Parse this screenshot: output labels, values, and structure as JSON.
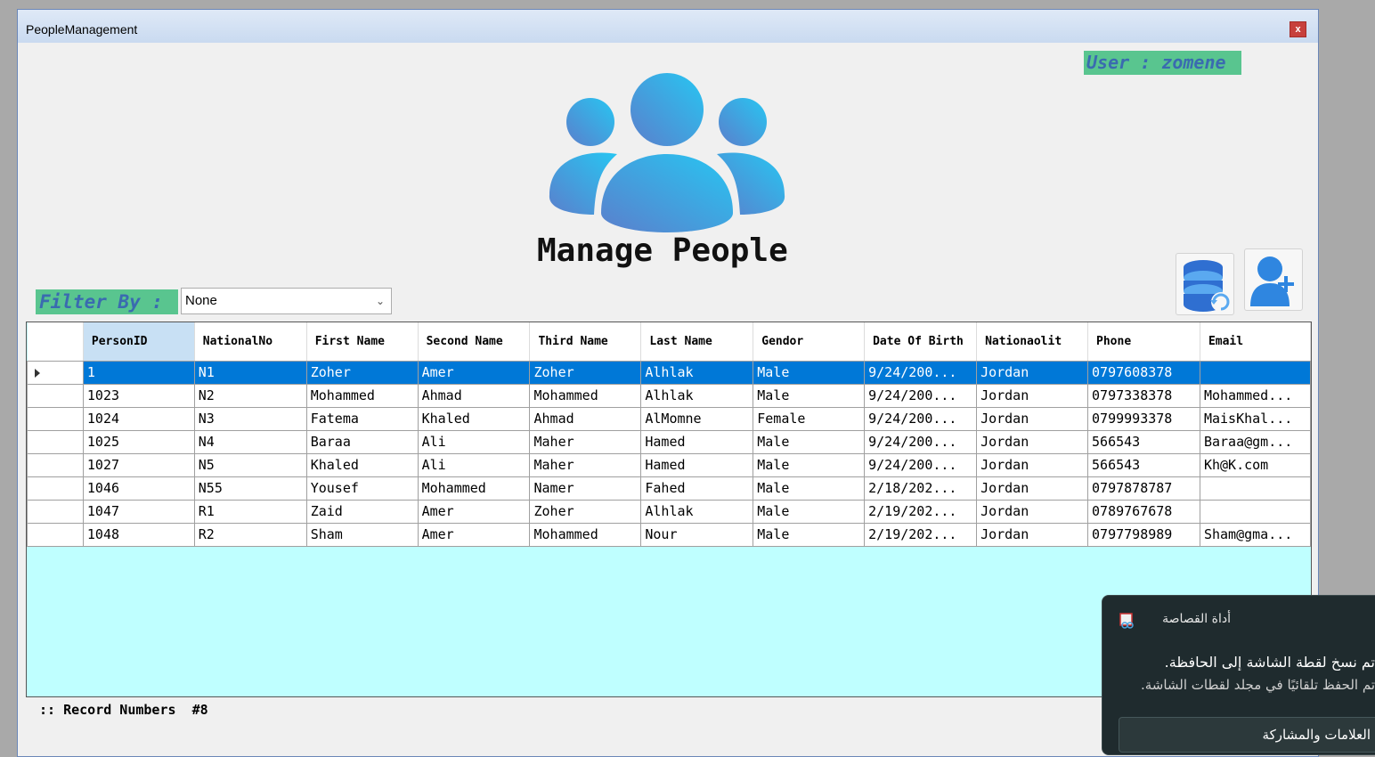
{
  "window": {
    "title": "PeopleManagement",
    "close_label": "x"
  },
  "user_badge": {
    "text": "User : zomene"
  },
  "page": {
    "title": "Manage People"
  },
  "filter": {
    "label": "Filter By :",
    "selected": "None"
  },
  "toolbar": {
    "refresh_icon": "database-refresh-icon",
    "add_icon": "add-person-icon"
  },
  "grid": {
    "columns": [
      "PersonID",
      "NationalNo",
      "First Name",
      "Second Name",
      "Third Name",
      "Last Name",
      "Gendor",
      "Date Of Birth",
      "Nationaolit",
      "Phone",
      "Email"
    ],
    "rows": [
      [
        "1",
        "N1",
        "Zoher",
        "Amer",
        "Zoher",
        "Alhlak",
        "Male",
        "9/24/200...",
        "Jordan",
        "0797608378",
        ""
      ],
      [
        "1023",
        "N2",
        "Mohammed",
        "Ahmad",
        "Mohammed",
        "Alhlak",
        "Male",
        "9/24/200...",
        "Jordan",
        "0797338378",
        "Mohammed..."
      ],
      [
        "1024",
        "N3",
        "Fatema",
        "Khaled",
        "Ahmad",
        "AlMomne",
        "Female",
        "9/24/200...",
        "Jordan",
        "0799993378",
        "MaisKhal..."
      ],
      [
        "1025",
        "N4",
        "Baraa",
        "Ali",
        "Maher",
        "Hamed",
        "Male",
        "9/24/200...",
        "Jordan",
        "566543",
        "Baraa@gm..."
      ],
      [
        "1027",
        "N5",
        "Khaled",
        "Ali",
        "Maher",
        "Hamed",
        "Male",
        "9/24/200...",
        "Jordan",
        "566543",
        "Kh@K.com"
      ],
      [
        "1046",
        "N55",
        "Yousef",
        "Mohammed",
        "Namer",
        "Fahed",
        "Male",
        "2/18/202...",
        "Jordan",
        "0797878787",
        ""
      ],
      [
        "1047",
        "R1",
        "Zaid",
        "Amer",
        "Zoher",
        "Alhlak",
        "Male",
        "2/19/202...",
        "Jordan",
        "0789767678",
        ""
      ],
      [
        "1048",
        "R2",
        "Sham",
        "Amer",
        "Mohammed",
        "Nour",
        "Male",
        "2/19/202...",
        "Jordan",
        "0797798989",
        "Sham@gma..."
      ]
    ],
    "selected_row": 0
  },
  "footer": {
    "record_text": ":: Record Numbers  #8"
  },
  "toast": {
    "app_name": "أداة القصاصة",
    "message": "تم نسخ لقطة الشاشة إلى الحافظة.",
    "sub_message": "تم الحفظ تلقائيًا في مجلد لقطات الشاشة.",
    "action_label": "العلامات والمشاركة"
  },
  "colors": {
    "accent_green": "#59c58f",
    "accent_blue_text": "#3a6bb0",
    "selection": "#0078d7",
    "grid_bg": "#bfffff"
  }
}
